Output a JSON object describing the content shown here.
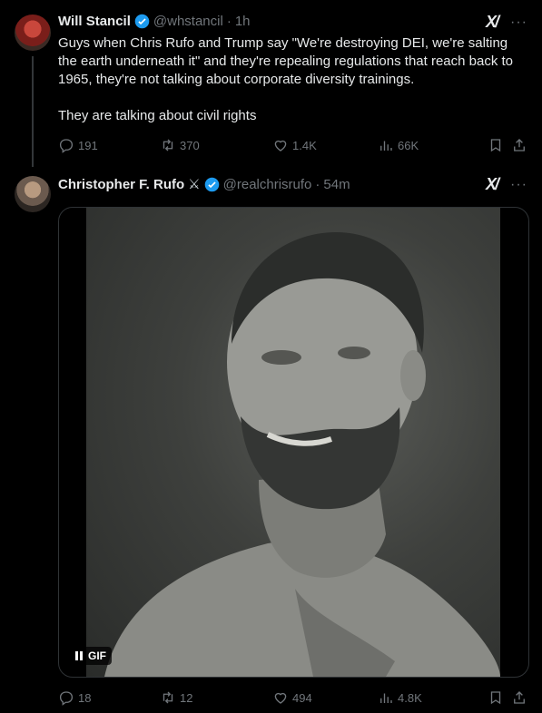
{
  "tweet1": {
    "display_name": "Will Stancil",
    "handle": "@whstancil",
    "time": "1h",
    "text": "Guys when Chris Rufo and Trump say \"We're destroying DEI, we're salting the earth underneath it\" and they're repealing regulations that reach back to 1965, they're not talking about corporate diversity trainings.\n\nThey are talking about civil rights",
    "replies": "191",
    "reposts": "370",
    "likes": "1.4K",
    "views": "66K"
  },
  "tweet2": {
    "display_name": "Christopher F. Rufo",
    "name_emoji": "⚔",
    "handle": "@realchrisrufo",
    "time": "54m",
    "media_badge": "GIF",
    "replies": "18",
    "reposts": "12",
    "likes": "494",
    "views": "4.8K"
  },
  "ui": {
    "separator": "·",
    "grok_label": "X/",
    "more_label": "···"
  },
  "colors": {
    "background": "#000000",
    "text": "#e7e9ea",
    "muted": "#71767b",
    "verified": "#1d9bf0"
  }
}
